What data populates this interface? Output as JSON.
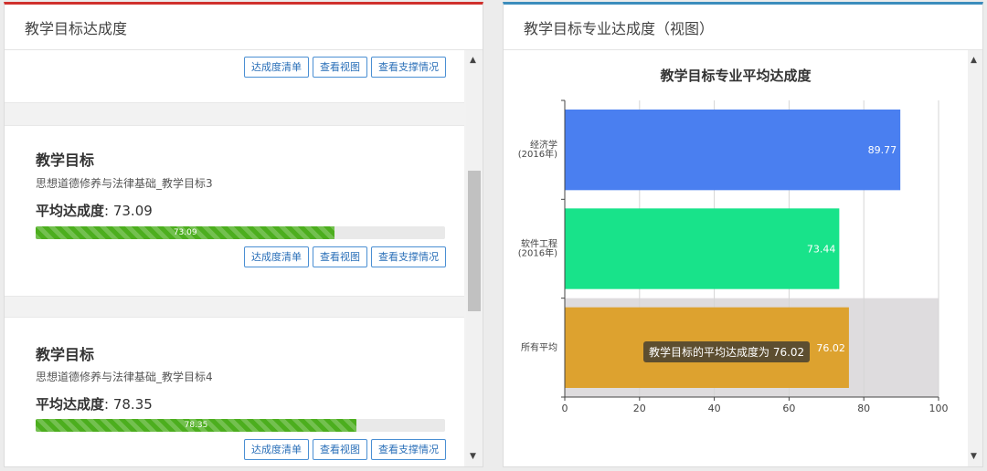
{
  "left_panel": {
    "title": "教学目标达成度",
    "buttons": {
      "list": "达成度清单",
      "view": "查看视图",
      "support": "查看支撑情况"
    },
    "cards": [
      {},
      {
        "heading": "教学目标",
        "course_target": "思想道德修养与法律基础_教学目标3",
        "avg_label": "平均达成度",
        "avg_value": "73.09",
        "progress": 73.09,
        "progress_label": "73.09"
      },
      {
        "heading": "教学目标",
        "course_target": "思想道德修养与法律基础_教学目标4",
        "avg_label": "平均达成度",
        "avg_value": "78.35",
        "progress": 78.35,
        "progress_label": "78.35"
      }
    ]
  },
  "right_panel": {
    "title": "教学目标专业达成度（视图）",
    "tooltip": "教学目标的平均达成度为 76.02"
  },
  "chart_data": {
    "type": "bar",
    "orientation": "horizontal",
    "title": "教学目标专业平均达成度",
    "categories": [
      [
        "经济学",
        "(2016年)"
      ],
      [
        "软件工程",
        "(2016年)"
      ],
      [
        "所有平均"
      ]
    ],
    "values": [
      89.77,
      73.44,
      76.02
    ],
    "value_labels": [
      "89.77",
      "73.44",
      "76.02"
    ],
    "colors": [
      "#4a7ff0",
      "#18e38a",
      "#dda22f"
    ],
    "xlim": [
      0,
      100
    ],
    "x_ticks": [
      0,
      20,
      40,
      60,
      80,
      100
    ],
    "grid": true,
    "highlighted_category_index": 2
  }
}
